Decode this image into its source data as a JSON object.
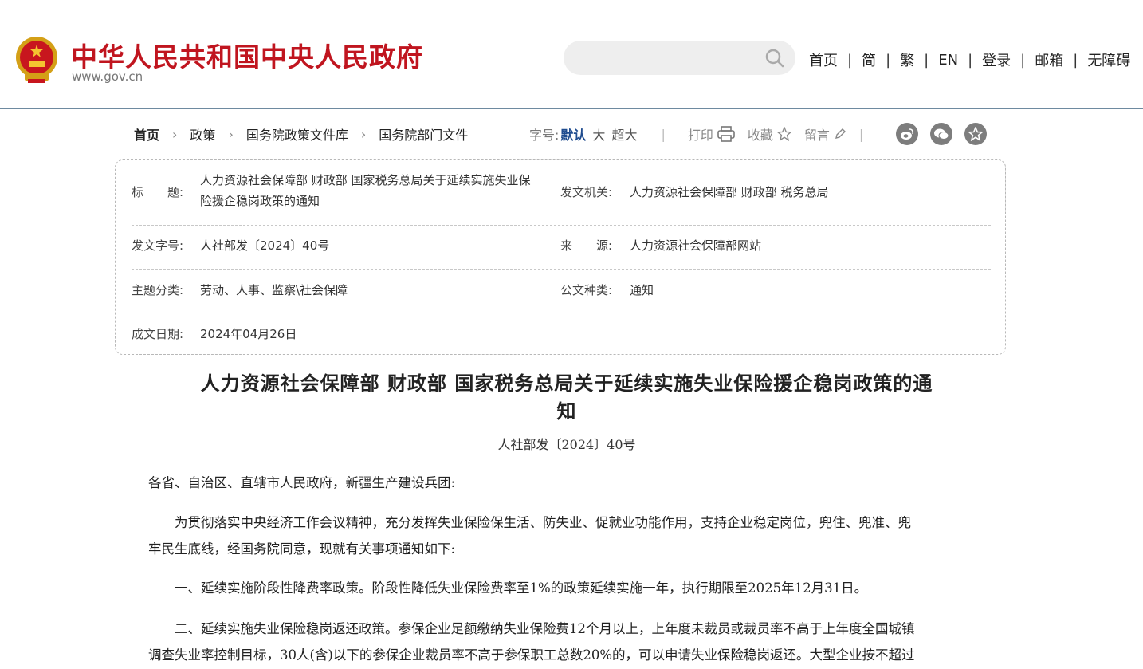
{
  "header": {
    "site_title": "中华人民共和国中央人民政府",
    "site_url": "www.gov.cn",
    "nav": [
      "首页",
      "简",
      "繁",
      "EN",
      "登录",
      "邮箱",
      "无障碍"
    ]
  },
  "breadcrumb": [
    "首页",
    "政策",
    "国务院政策文件库",
    "国务院部门文件"
  ],
  "tools": {
    "font_label": "字号:",
    "font_default": "默认",
    "font_large": "大",
    "font_xlarge": "超大",
    "print": "打印",
    "favorite": "收藏",
    "comment": "留言"
  },
  "meta": {
    "title_label": "标　　题:",
    "title_value_line1": "人力资源社会保障部 财政部 国家税务总局关于延续实施失业保",
    "title_value_line2": "险援企稳岗政策的通知",
    "issuer_label": "发文机关:",
    "issuer_value": "人力资源社会保障部 财政部 税务总局",
    "docno_label": "发文字号:",
    "docno_value": "人社部发〔2024〕40号",
    "source_label": "来　　源:",
    "source_value": "人力资源社会保障部网站",
    "topic_label": "主题分类:",
    "topic_value": "劳动、人事、监察\\社会保障",
    "type_label": "公文种类:",
    "type_value": "通知",
    "date_label": "成文日期:",
    "date_value": "2024年04月26日"
  },
  "article": {
    "title_line1": "人力资源社会保障部 财政部 国家税务总局关于延续实施失业保险援企稳岗政策的通",
    "title_line2": "知",
    "doc_number": "人社部发〔2024〕40号",
    "salutation": "各省、自治区、直辖市人民政府，新疆生产建设兵团:",
    "p1_line1": "　　为贯彻落实中央经济工作会议精神，充分发挥失业保险保生活、防失业、促就业功能作用，支持企业稳定岗位，兜住、兜准、兜",
    "p1_line2": "牢民生底线，经国务院同意，现就有关事项通知如下:",
    "p2": "　　一、延续实施阶段性降费率政策。阶段性降低失业保险费率至1%的政策延续实施一年，执行期限至2025年12月31日。",
    "p3_line1": "　　二、延续实施失业保险稳岗返还政策。参保企业足额缴纳失业保险费12个月以上，上年度未裁员或裁员率不高于上年度全国城镇",
    "p3_line2": "调查失业率控制目标，30人(含)以下的参保企业裁员率不高于参保职工总数20%的，可以申请失业保险稳岗返还。大型企业按不超过"
  },
  "colors": {
    "brand_red": "#c0151f",
    "link_blue": "#1f4c8f"
  }
}
